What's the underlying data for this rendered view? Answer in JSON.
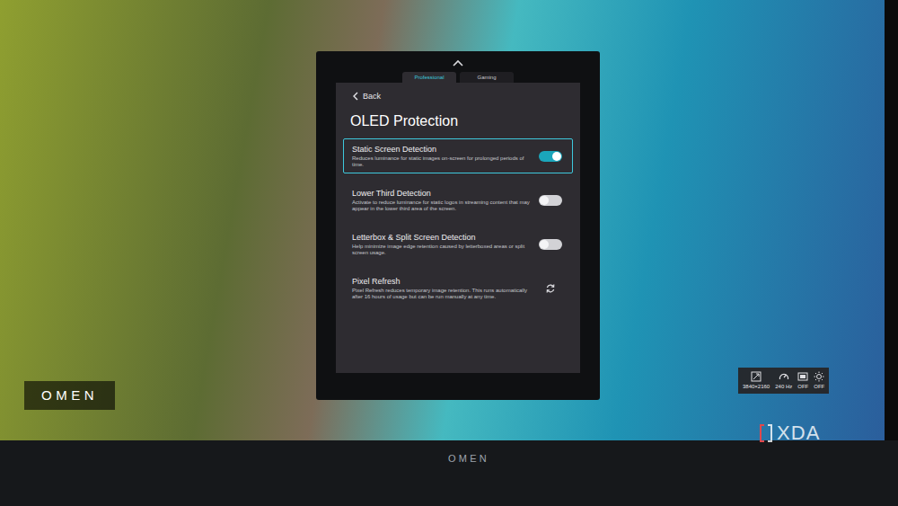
{
  "osd": {
    "tabs": [
      {
        "label": "Professional",
        "selected": true
      },
      {
        "label": "Gaming",
        "selected": false
      }
    ],
    "back": "Back",
    "title": "OLED Protection",
    "items": [
      {
        "kind": "toggle",
        "label": "Static Screen Detection",
        "description": "Reduces luminance for static images on-screen for prolonged periods of time.",
        "on": true,
        "selected": true
      },
      {
        "kind": "toggle",
        "label": "Lower Third Detection",
        "description": "Activate to reduce luminance for static logos in streaming content that may appear in the lower third area of the screen.",
        "on": false,
        "selected": false
      },
      {
        "kind": "toggle",
        "label": "Letterbox & Split Screen Detection",
        "description": "Help minimize image edge retention caused by letterboxed areas or split screen usage.",
        "on": false,
        "selected": false
      },
      {
        "kind": "action",
        "label": "Pixel Refresh",
        "description": "Pixel Refresh reduces temporary image retention. This runs automatically after 16 hours of usage but can be run manually at any time.",
        "selected": false
      }
    ]
  },
  "status": [
    {
      "kind": "resolution",
      "label": "3840×2160"
    },
    {
      "kind": "refresh",
      "label": "240 Hz"
    },
    {
      "kind": "hdr",
      "label": "OFF"
    },
    {
      "kind": "brightness",
      "label": "OFF"
    }
  ],
  "wallpaper_logo": "OMEN",
  "bezel_logo": "OMEN",
  "watermark": "XDA"
}
